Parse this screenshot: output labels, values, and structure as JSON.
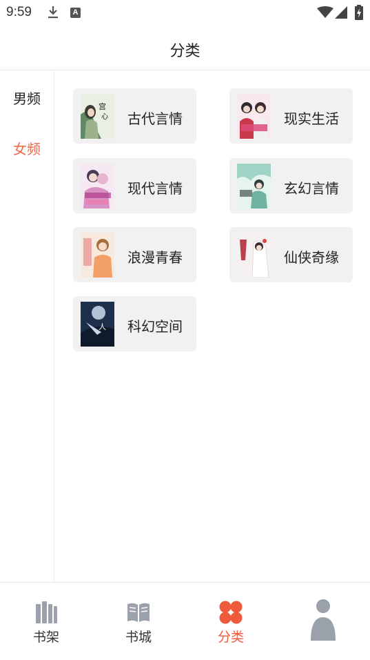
{
  "status_bar": {
    "time": "9:59",
    "letter_icon": "A"
  },
  "header": {
    "title": "分类"
  },
  "sidebar": {
    "items": [
      {
        "label": "男频",
        "active": false
      },
      {
        "label": "女频",
        "active": true
      }
    ]
  },
  "categories": [
    {
      "label": "古代言情",
      "cover_icon": "book-cover-icon"
    },
    {
      "label": "现实生活",
      "cover_icon": "book-cover-icon"
    },
    {
      "label": "现代言情",
      "cover_icon": "book-cover-icon"
    },
    {
      "label": "玄幻言情",
      "cover_icon": "book-cover-icon"
    },
    {
      "label": "浪漫青春",
      "cover_icon": "book-cover-icon"
    },
    {
      "label": "仙侠奇缘",
      "cover_icon": "book-cover-icon"
    },
    {
      "label": "科幻空间",
      "cover_icon": "book-cover-icon"
    }
  ],
  "bottom_nav": {
    "items": [
      {
        "label": "书架",
        "icon": "bookshelf-icon",
        "active": false
      },
      {
        "label": "书城",
        "icon": "open-book-icon",
        "active": false
      },
      {
        "label": "分类",
        "icon": "clover-icon",
        "active": true
      },
      {
        "label": "",
        "icon": "user-icon",
        "active": false
      }
    ]
  },
  "colors": {
    "accent": "#ef5a3c",
    "card_bg": "#f1f1f1",
    "icon_gray": "#9aa1ab"
  }
}
